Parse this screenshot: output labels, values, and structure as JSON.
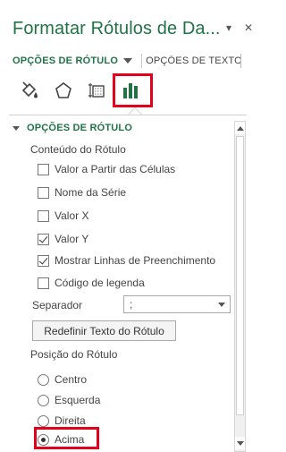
{
  "title": "Formatar Rótulos de Da...",
  "title_tools": {
    "dropdown_glyph": "▾",
    "close_glyph": "✕"
  },
  "tabs": {
    "active": "OPÇÕES DE RÓTULO",
    "other": "OPÇÕES DE TEXTO"
  },
  "icon_tabs": [
    "fill-line-icon",
    "effects-icon",
    "size-properties-icon",
    "label-options-icon"
  ],
  "accent_color": "#217346",
  "highlight_color": "#e3001b",
  "section": {
    "title": "OPÇÕES DE RÓTULO"
  },
  "content": {
    "heading": "Conteúdo do Rótulo",
    "options": [
      {
        "label": "Valor a Partir das Células",
        "checked": false
      },
      {
        "label": "Nome da Série",
        "checked": false
      },
      {
        "label": "Valor X",
        "checked": false
      },
      {
        "label": "Valor Y",
        "checked": true
      },
      {
        "label": "Mostrar Linhas de Preenchimento",
        "checked": true
      },
      {
        "label": "Código de legenda",
        "checked": false
      }
    ]
  },
  "separator": {
    "label": "Separador",
    "value": ";"
  },
  "reset_button": "Redefinir Texto do Rótulo",
  "position": {
    "heading": "Posição do Rótulo",
    "options": [
      {
        "label": "Centro",
        "selected": false
      },
      {
        "label": "Esquerda",
        "selected": false
      },
      {
        "label": "Direita",
        "selected": false
      },
      {
        "label": "Acima",
        "selected": true
      }
    ]
  }
}
